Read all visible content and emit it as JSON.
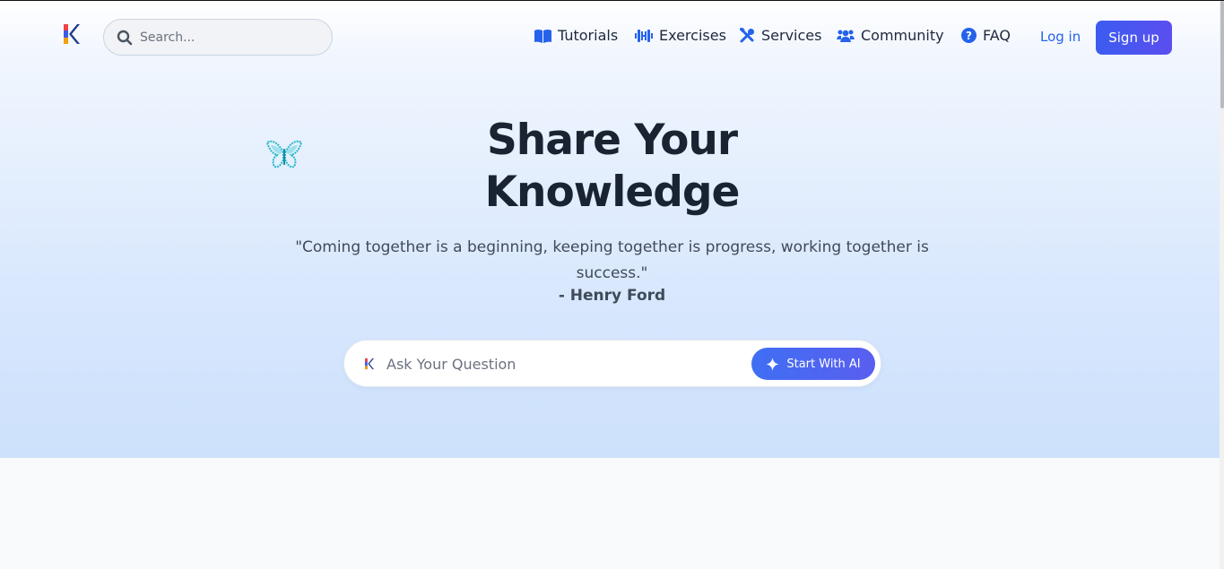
{
  "header": {
    "search_placeholder": "Search...",
    "nav": [
      {
        "label": "Tutorials",
        "icon": "book-open-icon"
      },
      {
        "label": "Exercises",
        "icon": "dumbbell-icon"
      },
      {
        "label": "Services",
        "icon": "tools-icon"
      },
      {
        "label": "Community",
        "icon": "users-icon"
      },
      {
        "label": "FAQ",
        "icon": "question-circle-icon"
      }
    ],
    "login_label": "Log in",
    "signup_label": "Sign up"
  },
  "hero": {
    "title_line1": "Share Your",
    "title_line2": "Knowledge",
    "quote": "\"Coming together is a beginning, keeping together is progress, working together is success.\"",
    "author": "- Henry Ford",
    "ask_placeholder": "Ask Your Question",
    "ai_button_label": "Start With AI"
  },
  "colors": {
    "accent": "#2563eb",
    "button_gradient_start": "#3b5cf0",
    "button_gradient_end": "#5b4ef0",
    "title": "#1a2332",
    "butterfly": "#22b8c9"
  }
}
